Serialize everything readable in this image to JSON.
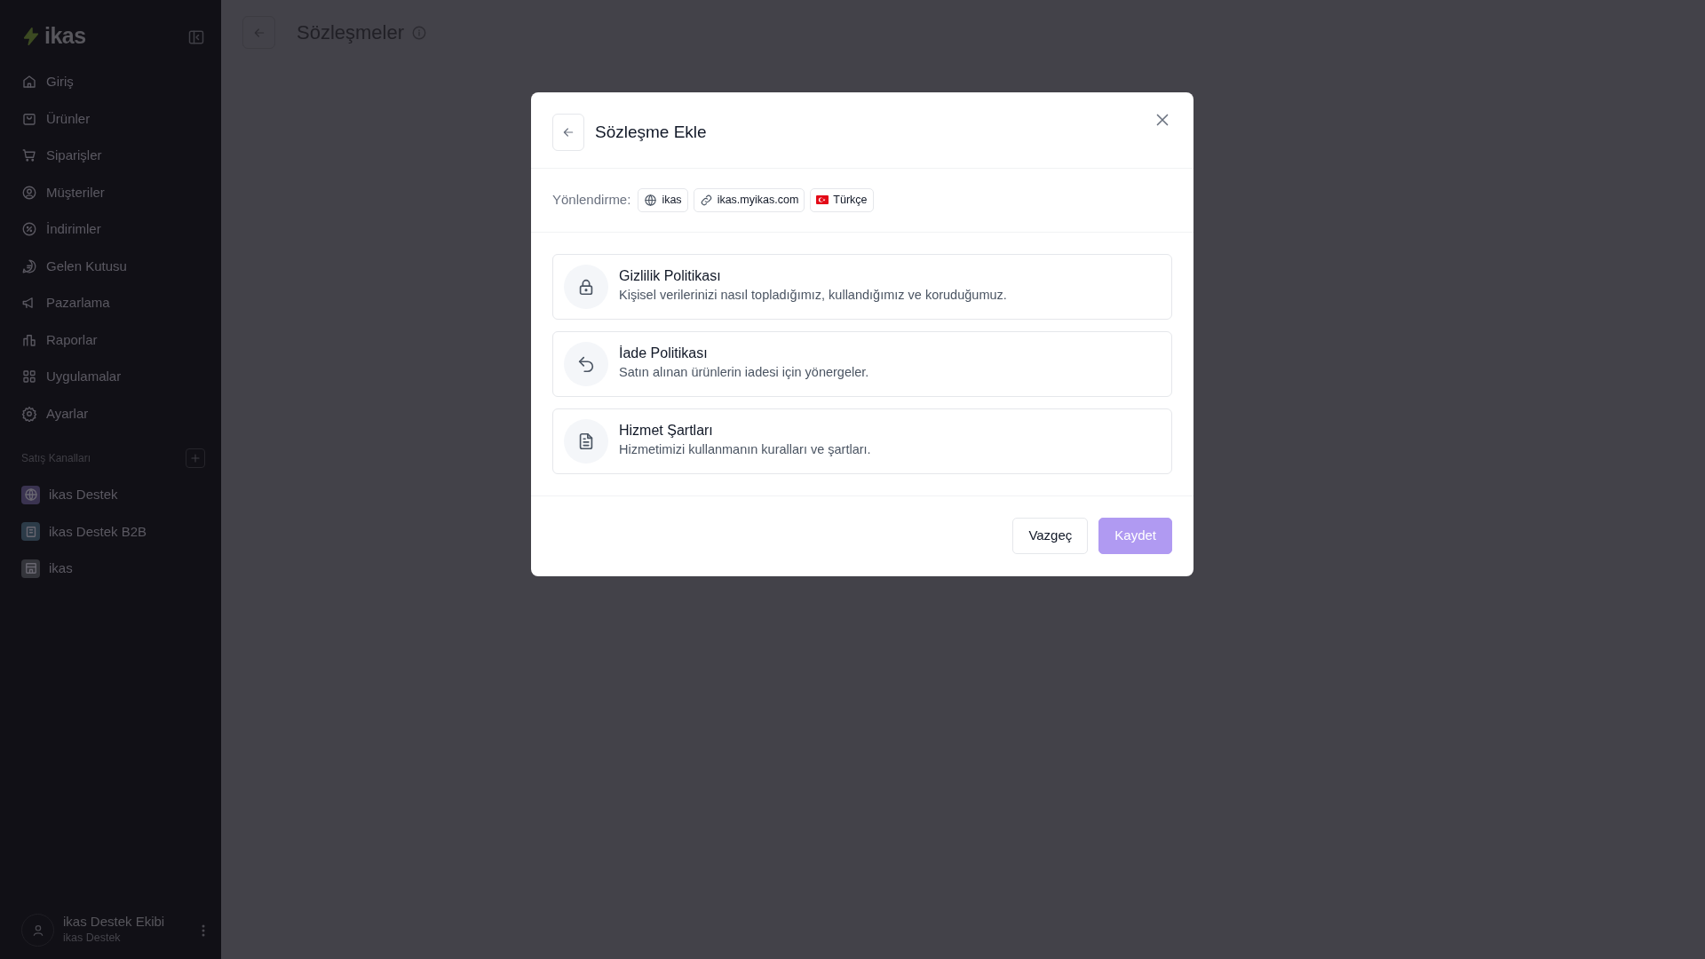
{
  "sidebar": {
    "logo": "ikas",
    "items": [
      {
        "label": "Giriş"
      },
      {
        "label": "Ürünler"
      },
      {
        "label": "Siparişler"
      },
      {
        "label": "Müşteriler"
      },
      {
        "label": "İndirimler"
      },
      {
        "label": "Gelen Kutusu"
      },
      {
        "label": "Pazarlama"
      },
      {
        "label": "Raporlar"
      },
      {
        "label": "Uygulamalar"
      },
      {
        "label": "Ayarlar"
      }
    ],
    "section_title": "Satış Kanalları",
    "channels": [
      {
        "label": "ikas Destek",
        "color": "#3a3350"
      },
      {
        "label": "ikas Destek B2B",
        "color": "#2c3b48"
      },
      {
        "label": "ikas",
        "color": "#34353b"
      }
    ],
    "user": {
      "name": "ikas Destek Ekibi",
      "subtitle": "ikas Destek"
    }
  },
  "page": {
    "title": "Sözleşmeler"
  },
  "modal": {
    "title": "Sözleşme Ekle",
    "redirect_label": "Yönlendirme:",
    "tags": [
      {
        "label": "ikas"
      },
      {
        "label": "ikas.myikas.com"
      },
      {
        "label": "Türkçe"
      }
    ],
    "options": [
      {
        "title": "Gizlilik Politikası",
        "description": "Kişisel verilerinizi nasıl topladığımız, kullandığımız ve koruduğumuz."
      },
      {
        "title": "İade Politikası",
        "description": "Satın alınan ürünlerin iadesi için yönergeler."
      },
      {
        "title": "Hizmet Şartları",
        "description": "Hizmetimizi kullanmanın kuralları ve şartları."
      }
    ],
    "buttons": [
      {
        "label": "Vazgeç",
        "kind": "secondary",
        "disabled": false
      },
      {
        "label": "Kaydet",
        "kind": "primary",
        "disabled": true
      }
    ]
  }
}
